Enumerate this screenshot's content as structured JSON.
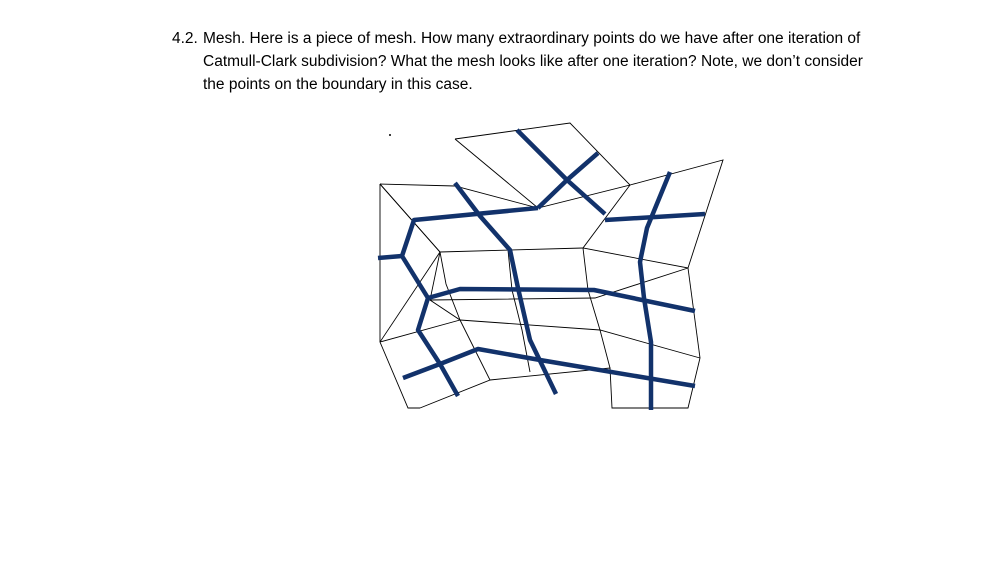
{
  "question": {
    "number": "4.2.",
    "text": "Mesh. Here is a piece of mesh. How many extraordinary points do we have after one iteration of Catmull-Clark subdivision? What the mesh looks like after one iteration? Note, we don’t consider the points on the boundary in this case."
  },
  "figure": {
    "mesh_line_color": "#000000",
    "subdivision_line_color": "#12326b"
  }
}
